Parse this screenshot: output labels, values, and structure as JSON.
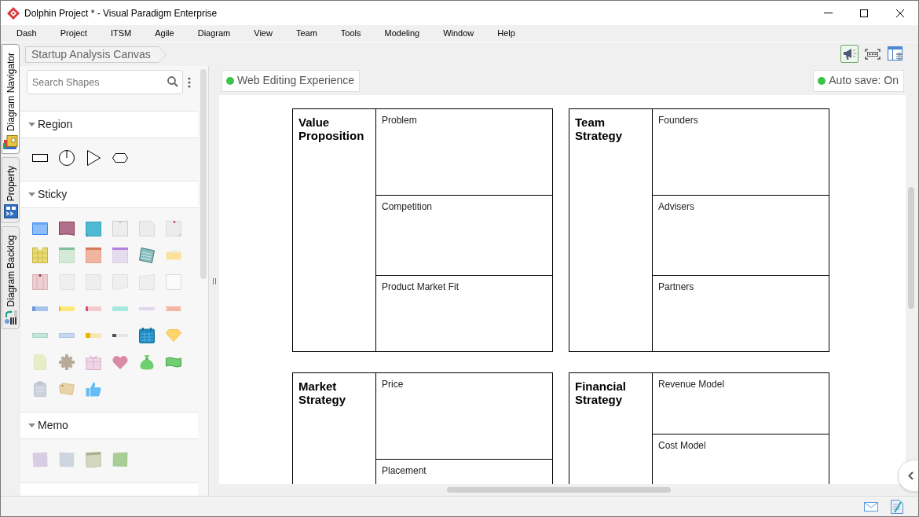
{
  "window": {
    "title": "Dolphin Project * - Visual Paradigm Enterprise"
  },
  "menu_bar": [
    "Dash",
    "Project",
    "ITSM",
    "Agile",
    "Diagram",
    "View",
    "Team",
    "Tools",
    "Modeling",
    "Window",
    "Help"
  ],
  "side_tabs": [
    {
      "label": "Diagram Navigator",
      "selected": true
    },
    {
      "label": "Property",
      "selected": false
    },
    {
      "label": "Diagram Backlog",
      "selected": false
    }
  ],
  "breadcrumb": {
    "label": "Startup Analysis Canvas"
  },
  "toolbar": [
    {
      "kind": "announce",
      "selected": true
    },
    {
      "kind": "fit",
      "selected": false
    },
    {
      "kind": "layout",
      "selected": false
    }
  ],
  "shape_panel": {
    "search": {
      "placeholder": "Search Shapes"
    },
    "sections": [
      {
        "title": "Region",
        "expanded": true
      },
      {
        "title": "Sticky",
        "expanded": true
      },
      {
        "title": "Memo",
        "expanded": true
      }
    ]
  },
  "canvas": {
    "badges": [
      {
        "label": "Web Editing Experience"
      },
      {
        "label": "Auto save: On"
      }
    ],
    "blocks": [
      {
        "title": "Value Proposition",
        "cells": [
          "Problem",
          "Competition",
          "Product Market Fit"
        ]
      },
      {
        "title": "Team Strategy",
        "cells": [
          "Founders",
          "Advisers",
          "Partners"
        ]
      },
      {
        "title": "Market Strategy",
        "cells": [
          "Price",
          "Placement"
        ]
      },
      {
        "title": "Financial Strategy",
        "cells": [
          "Revenue Model",
          "Cost Model"
        ]
      }
    ]
  }
}
